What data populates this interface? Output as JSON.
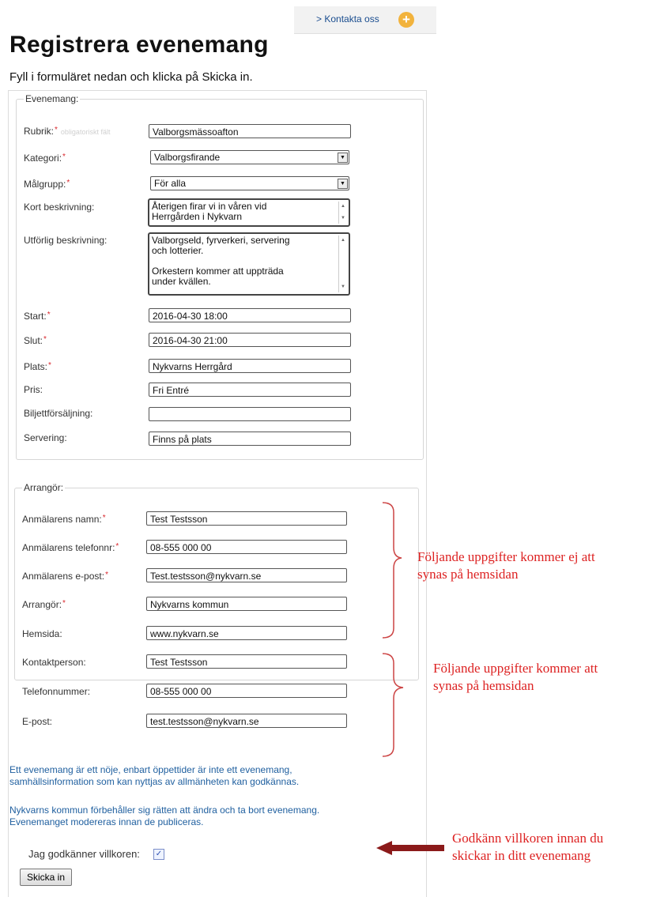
{
  "header": {
    "contact_link": "> Kontakta oss",
    "plus_icon": "+"
  },
  "page": {
    "title": "Registrera evenemang",
    "intro": "Fyll i formuläret nedan och klicka på Skicka in."
  },
  "event": {
    "legend": "Evenemang:",
    "rubrik_label": "Rubrik:",
    "rubrik_ghost": "obligatoriskt fält",
    "rubrik_value": "Valborgsmässoafton",
    "kategori_label": "Kategori:",
    "kategori_value": "Valborgsfirande",
    "malgrupp_label": "Målgrupp:",
    "malgrupp_value": "För alla",
    "kort_label": "Kort beskrivning:",
    "kort_value": "Återigen firar vi in våren vid\nHerrgården i Nykvarn",
    "utforlig_label": "Utförlig beskrivning:",
    "utforlig_value": "Valborgseld, fyrverkeri, servering\noch lotterier.\n\nOrkestern kommer att uppträda\nunder kvällen.",
    "start_label": "Start:",
    "start_value": "2016-04-30 18:00",
    "slut_label": "Slut:",
    "slut_value": "2016-04-30 21:00",
    "plats_label": "Plats:",
    "plats_value": "Nykvarns Herrgård",
    "pris_label": "Pris:",
    "pris_value": "Fri Entré",
    "biljett_label": "Biljettförsäljning:",
    "biljett_value": "",
    "servering_label": "Servering:",
    "servering_value": "Finns på plats"
  },
  "organizer": {
    "legend": "Arrangör:",
    "namn_label": "Anmälarens namn:",
    "namn_value": "Test Testsson",
    "telefon_label": "Anmälarens telefonnr:",
    "telefon_value": "08-555 000 00",
    "epost_label": "Anmälarens e-post:",
    "epost_value": "Test.testsson@nykvarn.se",
    "arrangor_label": "Arrangör:",
    "arrangor_value": "Nykvarns kommun",
    "hemsida_label": "Hemsida:",
    "hemsida_value": "www.nykvarn.se",
    "kontakt_label": "Kontaktperson:",
    "kontakt_value": "Test Testsson",
    "tel_label": "Telefonnummer:",
    "tel_value": "08-555 000 00",
    "mail_label": "E-post:",
    "mail_value": "test.testsson@nykvarn.se"
  },
  "notes": {
    "note1": "Ett evenemang är ett nöje, enbart öppettider är inte ett evenemang,\nsamhällsinformation som kan nyttjas av allmänheten kan godkännas.",
    "note2": "Nykvarns kommun förbehåller sig rätten att ändra och ta bort evenemang.\nEvenemanget modereras innan de publiceras."
  },
  "terms": {
    "label": "Jag godkänner villkoren:",
    "checked": true,
    "check_mark": "✓"
  },
  "submit_label": "Skicka in",
  "annotations": {
    "hidden": "Följande uppgifter kommer ej att\nsynas på hemsidan",
    "visible": "Följande uppgifter kommer att\nsynas på hemsidan",
    "approve": "Godkänn villkoren innan du\nskickar in ditt evenemang"
  },
  "colors": {
    "required": "#d9262c",
    "annotation": "#dd2222",
    "arrow": "#8b1a1a",
    "note_text": "#1f5f9f"
  }
}
